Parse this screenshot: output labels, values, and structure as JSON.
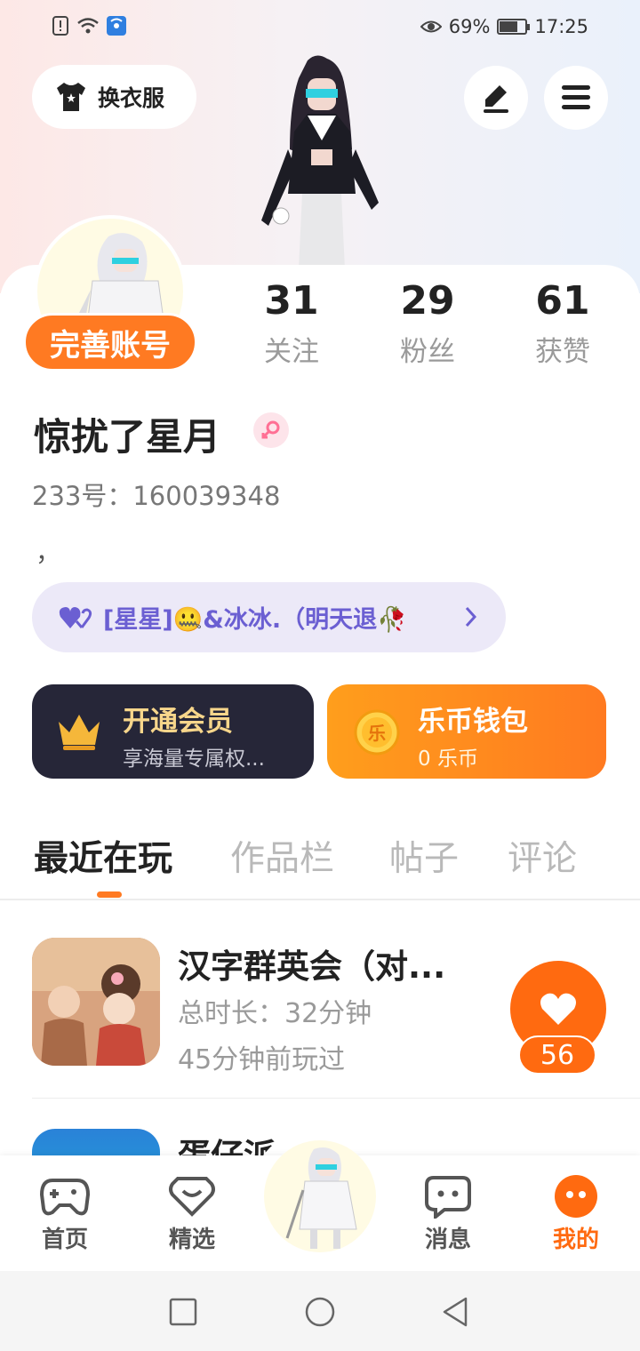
{
  "status_bar": {
    "battery": "69%",
    "time": "17:25",
    "battery_level": 0.69
  },
  "header": {
    "outfit_label": "换衣服"
  },
  "profile": {
    "complete_account_label": "完善账号",
    "stats": [
      {
        "value": "31",
        "label": "关注"
      },
      {
        "value": "29",
        "label": "粉丝"
      },
      {
        "value": "61",
        "label": "获赞"
      }
    ],
    "username": "惊扰了星月",
    "uid": "233号：160039348",
    "bio": "，",
    "group_text": "[星星]🤐&冰冰.（明天退🥀"
  },
  "cards": {
    "vip": {
      "title": "开通会员",
      "subtitle": "享海量专属权..."
    },
    "wallet": {
      "title": "乐币钱包",
      "subtitle": "0 乐币",
      "coin_glyph": "乐"
    }
  },
  "tabs": [
    "最近在玩",
    "作品栏",
    "帖子",
    "评论"
  ],
  "games": [
    {
      "title": "汉字群英会（对...",
      "duration": "总时长：32分钟",
      "last_played": "45分钟前玩过",
      "likes": "56"
    },
    {
      "title": "蛋仔派"
    }
  ],
  "bottom_nav": [
    {
      "label": "首页",
      "icon": "gamepad-icon"
    },
    {
      "label": "精选",
      "icon": "heart-badge-icon"
    },
    {
      "label": "消息",
      "icon": "chat-icon"
    },
    {
      "label": "我的",
      "icon": "profile-dots-icon"
    }
  ],
  "colors": {
    "accent": "#ff7a22",
    "group_text": "#6b5fd2",
    "vip_bg": "#262638"
  }
}
